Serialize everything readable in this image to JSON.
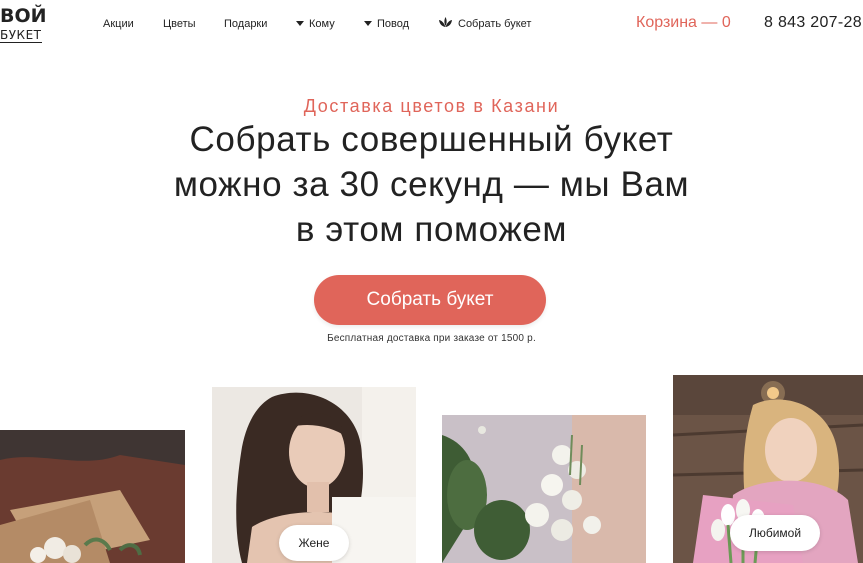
{
  "logo": {
    "line1": "ВОЙ",
    "line2": "БУКЕТ"
  },
  "nav": {
    "items": [
      {
        "label": "Акции",
        "icon": null
      },
      {
        "label": "Цветы",
        "icon": null
      },
      {
        "label": "Подарки",
        "icon": null
      },
      {
        "label": "Кому",
        "icon": "caret-down-icon"
      },
      {
        "label": "Повод",
        "icon": "caret-down-icon"
      },
      {
        "label": "Собрать букет",
        "icon": "lotus-icon"
      }
    ]
  },
  "cart": {
    "label": "Корзина — 0"
  },
  "phone": "8 843 207-28",
  "hero": {
    "subtitle": "Доставка цветов в Казани",
    "headline_line1": "Собрать совершенный букет",
    "headline_line2": "можно за 30 секунд — мы Вам",
    "headline_line3": "в этом поможем",
    "cta_label": "Собрать букет",
    "note": "Бесплатная доставка при заказе от 1500 р."
  },
  "cards": [
    {
      "label": ""
    },
    {
      "label": "Жене"
    },
    {
      "label": ""
    },
    {
      "label": "Любимой"
    }
  ],
  "colors": {
    "accent": "#e0655a",
    "text": "#222222",
    "background": "#ffffff"
  }
}
